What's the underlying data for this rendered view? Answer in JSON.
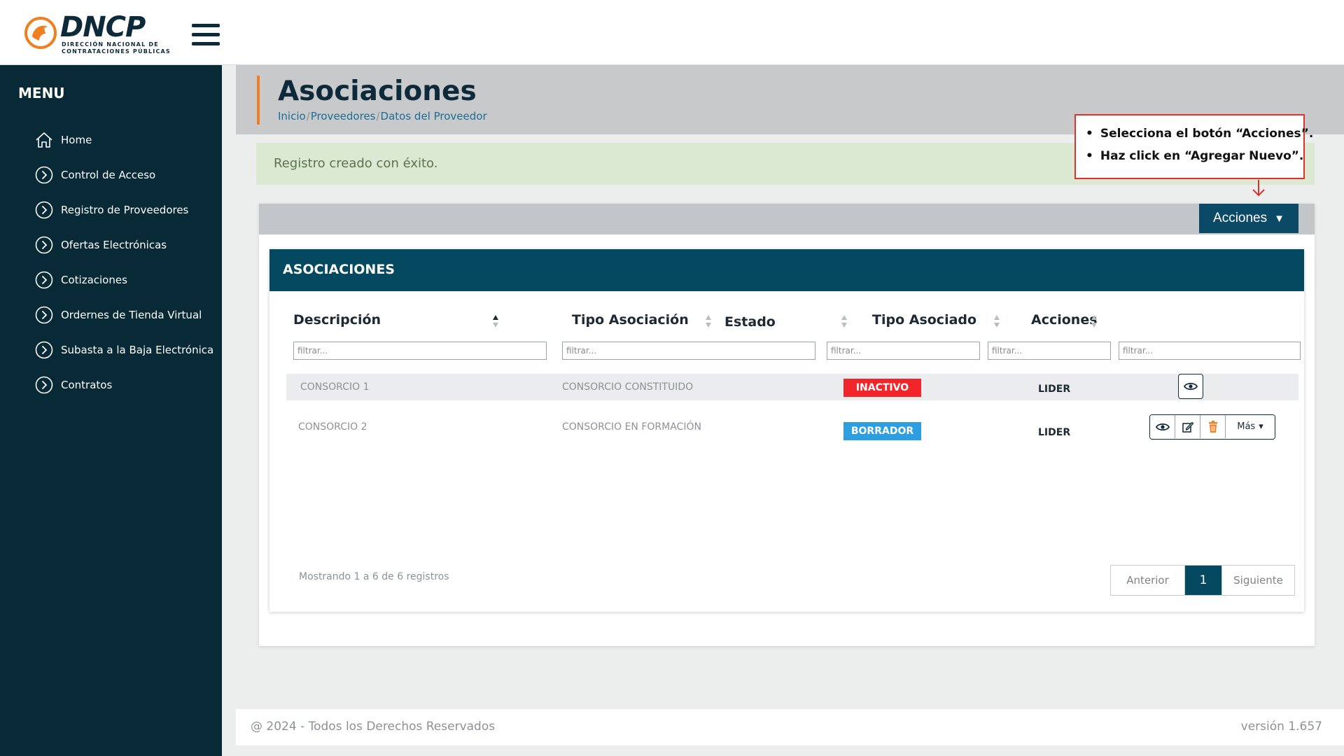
{
  "brand": {
    "name": "DNCP",
    "subtitle_line1": "DIRECCIÓN NACIONAL DE",
    "subtitle_line2": "CONTRATACIONES PÚBLICAS",
    "accent_color": "#f07f22"
  },
  "sidebar": {
    "title": "MENU",
    "items": [
      {
        "label": "Home",
        "icon": "home-icon"
      },
      {
        "label": "Control de Acceso",
        "icon": "chevron-circle-icon"
      },
      {
        "label": "Registro de Proveedores",
        "icon": "chevron-circle-icon"
      },
      {
        "label": "Ofertas Electrónicas",
        "icon": "chevron-circle-icon"
      },
      {
        "label": "Cotizaciones",
        "icon": "chevron-circle-icon"
      },
      {
        "label": "Ordernes de Tienda Virtual",
        "icon": "chevron-circle-icon"
      },
      {
        "label": "Subasta a la Baja Electrónica",
        "icon": "chevron-circle-icon"
      },
      {
        "label": "Contratos",
        "icon": "chevron-circle-icon"
      }
    ]
  },
  "page": {
    "title": "Asociaciones",
    "breadcrumb": [
      "Inicio",
      "Proveedores",
      "Datos del Proveedor"
    ],
    "breadcrumb_sep": "/"
  },
  "alert": {
    "message": "Registro creado con éxito."
  },
  "callout": {
    "lines": [
      "Selecciona el botón “Acciones”.",
      "Haz click en “Agregar Nuevo”."
    ],
    "border_color": "#d9342b"
  },
  "toolbar": {
    "acciones_label": "Acciones",
    "acciones_caret": "▼"
  },
  "table": {
    "title": "ASOCIACIONES",
    "columns": [
      "Descripción",
      "Tipo Asociación",
      "Estado",
      "Tipo Asociado",
      "Acciones"
    ],
    "filter_placeholder": "filtrar...",
    "rows": [
      {
        "descripcion": "CONSORCIO 1",
        "tipo_asociacion": "CONSORCIO CONSTITUIDO",
        "estado": "INACTIVO",
        "estado_color": "#f0262b",
        "tipo_asociado": "LIDER"
      },
      {
        "descripcion": "CONSORCIO 2",
        "tipo_asociacion": "CONSORCIO EN FORMACIÓN",
        "estado": "BORRADOR",
        "estado_color": "#2d9fe0",
        "tipo_asociado": "LIDER"
      }
    ],
    "mas_label": "Más",
    "mas_caret": "▾",
    "info": "Mostrando 1 a 6 de 6 registros",
    "pagination": {
      "prev": "Anterior",
      "current": "1",
      "next": "Siguiente"
    }
  },
  "footer": {
    "copyright": "@ 2024 - Todos los Derechos Reservados",
    "version": "versión 1.657"
  }
}
